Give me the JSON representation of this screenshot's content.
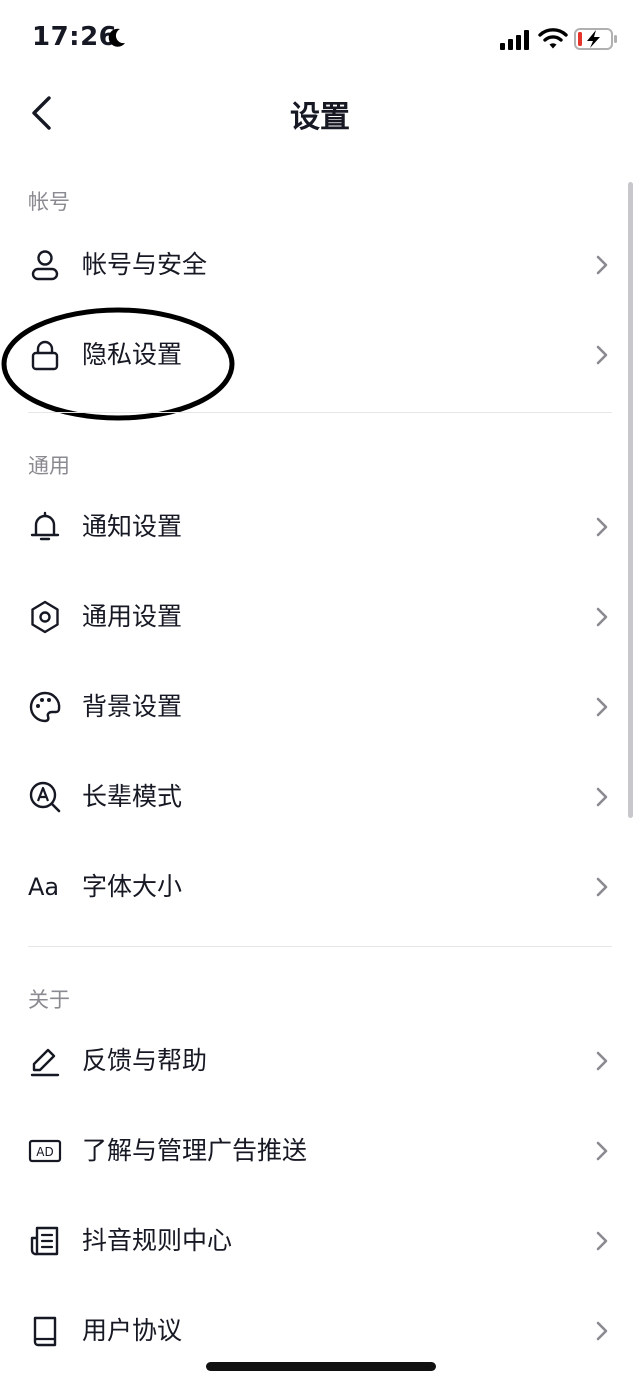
{
  "status": {
    "time": "17:26"
  },
  "nav": {
    "title": "设置"
  },
  "sections": [
    {
      "header": "帐号",
      "items": [
        {
          "label": "帐号与安全",
          "icon": "person-icon"
        },
        {
          "label": "隐私设置",
          "icon": "lock-icon"
        }
      ]
    },
    {
      "header": "通用",
      "items": [
        {
          "label": "通知设置",
          "icon": "bell-icon"
        },
        {
          "label": "通用设置",
          "icon": "gear-icon"
        },
        {
          "label": "背景设置",
          "icon": "palette-icon"
        },
        {
          "label": "长辈模式",
          "icon": "elder-mode-icon"
        },
        {
          "label": "字体大小",
          "icon": "font-size-icon",
          "icon_text": "Aa"
        }
      ]
    },
    {
      "header": "关于",
      "items": [
        {
          "label": "反馈与帮助",
          "icon": "pencil-icon"
        },
        {
          "label": "了解与管理广告推送",
          "icon": "ad-icon",
          "icon_text": "AD"
        },
        {
          "label": "抖音规则中心",
          "icon": "document-icon"
        },
        {
          "label": "用户协议",
          "icon": "book-icon"
        }
      ]
    }
  ]
}
